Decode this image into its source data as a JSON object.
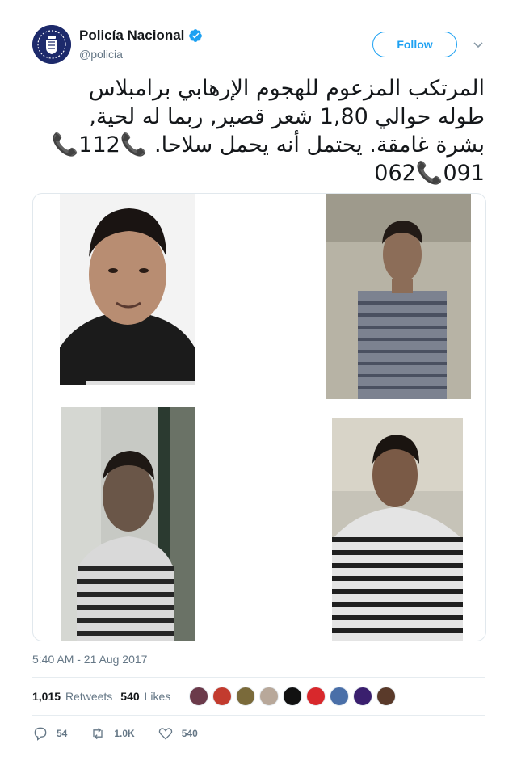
{
  "account": {
    "name": "Policía Nacional",
    "handle": "@policia",
    "follow_label": "Follow"
  },
  "tweet": {
    "lines": [
      "المرتكب المزعوم للهجوم الإرهابي برامبلاس",
      "طوله حوالي 1,80    شعر قصير, ربما له لحية,",
      "بشرة غامقة.  يحتمل أنه يحمل سلاحا. 📞112📞",
      "091📞062"
    ]
  },
  "timestamp": "5:40 AM - 21 Aug 2017",
  "stats": {
    "retweets_count": "1,015",
    "retweets_label": "Retweets",
    "likes_count": "540",
    "likes_label": "Likes",
    "liker_avatar_colors": [
      "#6b3a4a",
      "#c23b2e",
      "#7a6a3a",
      "#b8a89a",
      "#111111",
      "#d8282c",
      "#4a6fa8",
      "#3a1f6e",
      "#5a3a2a"
    ]
  },
  "actions": {
    "replies": "54",
    "retweets": "1.0K",
    "likes": "540"
  },
  "colors": {
    "accent": "#1da1f2",
    "secondary_text": "#657786",
    "primary_text": "#14171a"
  }
}
